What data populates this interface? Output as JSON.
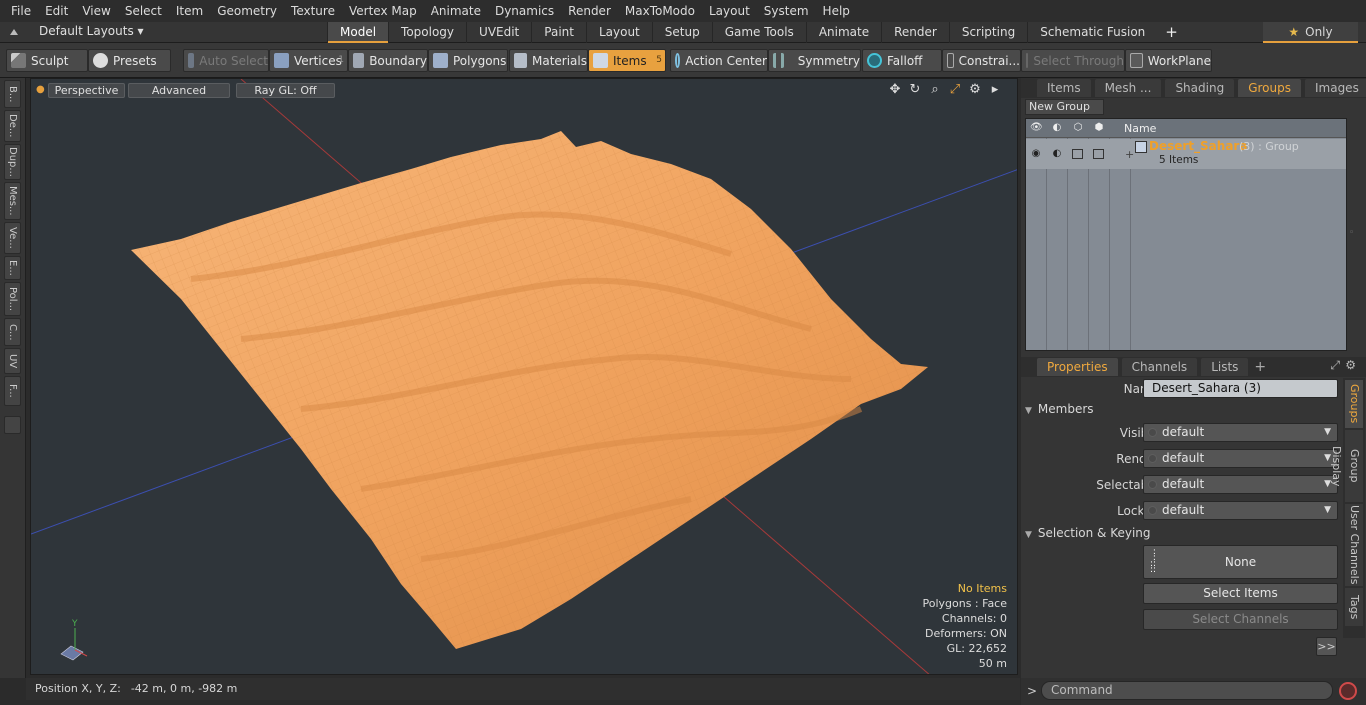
{
  "menu": [
    "File",
    "Edit",
    "View",
    "Select",
    "Item",
    "Geometry",
    "Texture",
    "Vertex Map",
    "Animate",
    "Dynamics",
    "Render",
    "MaxToModo",
    "Layout",
    "System",
    "Help"
  ],
  "layouts_label": "Default Layouts ▾",
  "tabs": [
    "Model",
    "Topology",
    "UVEdit",
    "Paint",
    "Layout",
    "Setup",
    "Game Tools",
    "Animate",
    "Render",
    "Scripting",
    "Schematic Fusion"
  ],
  "tab_add": "+",
  "only_label": "Only",
  "toolbar": {
    "sculpt": "Sculpt",
    "presets": "Presets",
    "auto_select": "Auto Select",
    "vertices": "Vertices",
    "vertices_count": "1",
    "boundary": "Boundary",
    "polygons": "Polygons",
    "materials": "Materials",
    "items": "Items",
    "items_count": "5",
    "action_center": "Action Center",
    "symmetry": "Symmetry",
    "falloff": "Falloff",
    "constraints": "Constrai...",
    "select_through": "Select Through",
    "workplane": "WorkPlane"
  },
  "left_tabs": [
    "B...",
    "De...",
    "Dup...",
    "Mes...",
    "Ve...",
    "E...",
    "Pol...",
    "C...",
    "UV",
    "F..."
  ],
  "viewport": {
    "view": "Perspective",
    "mode": "Advanced",
    "raygl": "Ray GL: Off",
    "stats": {
      "items": "No Items",
      "polygons": "Polygons : Face",
      "channels": "Channels: 0",
      "deformers": "Deformers: ON",
      "gl": "GL: 22,652",
      "scale": "50 m"
    },
    "axis_y": "Y"
  },
  "status": {
    "label": "Position X, Y, Z:",
    "value": "-42 m, 0 m, -982 m"
  },
  "right_tabs": [
    "Items",
    "Mesh ...",
    "Shading",
    "Groups",
    "Images"
  ],
  "new_group": "New Group",
  "group_list": {
    "header": "Name",
    "group_name": "Desert_Sahara",
    "group_suffix": "(3) : Group",
    "group_items": "5 Items"
  },
  "props_tabs": [
    "Properties",
    "Channels",
    "Lists"
  ],
  "props": {
    "name_label": "Name",
    "name_value": "Desert_Sahara (3)",
    "members_section": "Members",
    "visible_label": "Visible",
    "visible_value": "default",
    "render_label": "Render",
    "render_value": "default",
    "selectable_label": "Selectable",
    "selectable_value": "default",
    "locked_label": "Locked",
    "locked_value": "default",
    "sel_section": "Selection & Keying",
    "none_btn": "None",
    "select_items": "Select Items",
    "select_channels": "Select Channels",
    "more": ">>"
  },
  "side_tabs": [
    "Groups",
    "Group Display",
    "User Channels",
    "Tags"
  ],
  "command": {
    "prompt": ">",
    "placeholder": "Command"
  },
  "colors": {
    "accent": "#e6a03d",
    "terrain": "#f2a862",
    "viewport_bg": "#2f353a"
  }
}
